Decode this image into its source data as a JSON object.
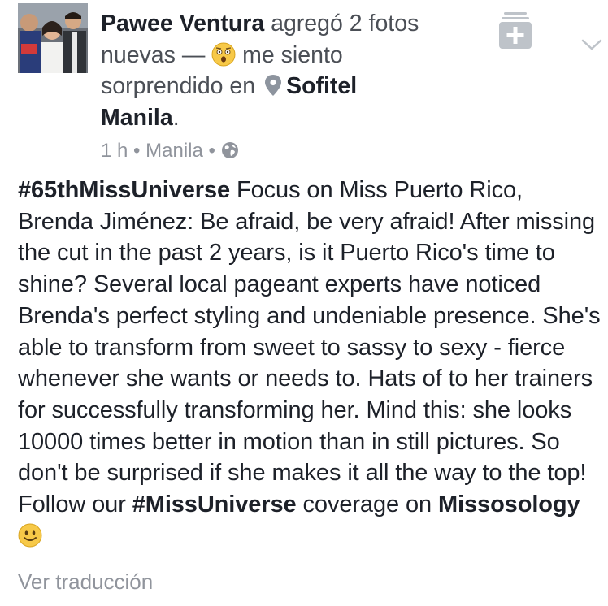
{
  "header": {
    "author": "Pawee Ventura",
    "action_line1": "agregó 2 fotos",
    "action_line2": "nuevas —",
    "feeling": "me siento",
    "feeling_line2": "sorprendido en",
    "place_line1": "Sofitel",
    "place_line2": "Manila",
    "period": "."
  },
  "meta": {
    "time": "1 h",
    "sep1": "•",
    "location": "Manila",
    "sep2": "•",
    "privacy_icon": "globe-icon"
  },
  "post": {
    "hashtag1": "#65thMissUniverse",
    "text1": " Focus on Miss Puerto Rico, Brenda Jiménez: Be afraid, be very afraid! After missing the cut in the past 2 years, is it Puerto Rico's time to shine? Several local pageant experts have noticed Brenda's perfect styling and undeniable presence. She's able to transform from sweet to sassy to sexy - fierce whenever she wants or needs to. Hats of to her trainers for successfully transforming her. Mind this: she looks 10000 times better in motion than in still pictures. So don't be surprised if she makes it all the way to the top! Follow our ",
    "hashtag2": "#MissUniverse",
    "text2": " coverage on ",
    "page_name": "Missosology",
    "text3": " "
  },
  "footer": {
    "translate": "Ver traducción"
  },
  "icons": {
    "add": "add-to-collection-icon",
    "chevron": "chevron-down-icon",
    "feeling": "surprised-face-icon",
    "place": "map-pin-icon",
    "smile": "smiley-icon"
  },
  "colors": {
    "text": "#1d2129",
    "secondary": "#4b4f56",
    "muted": "#90949c",
    "emoji": "#f7c948"
  }
}
